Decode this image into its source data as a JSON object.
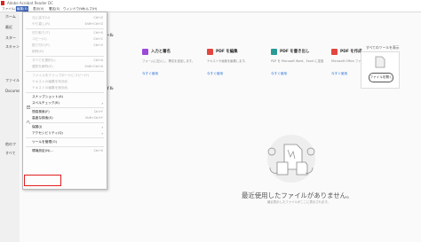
{
  "titlebar": {
    "title": "Adobe Acrobat Reader DC"
  },
  "menubar": {
    "items": [
      "ファイル(F)",
      "編集(E)",
      "表示(V)",
      "署名(S)",
      "ウィンドウ(W)",
      "ヘルプ(H)"
    ],
    "active_index": 1
  },
  "leftpane": {
    "labels": [
      "ホーム",
      "最近",
      "スター",
      "スキャン",
      "ファイル",
      "Document",
      "他のフ",
      "すべて"
    ]
  },
  "tools": {
    "section_suffix": "ール",
    "all_tools_link": "すべてのツールを表示",
    "cards": [
      {
        "title": "入力と署名",
        "desc": "フォームに記入し、署名を追加します。",
        "link": "今すぐ使用",
        "color": "#9c4ad8"
      },
      {
        "title": "PDF を編集",
        "desc": "テキストや画像を編集します。",
        "link": "今すぐ使用",
        "color": "#e2473f"
      },
      {
        "title": "PDF を書き出し",
        "desc": "PDF を Microsoft Word、Excel に変換",
        "link": "今すぐ使用",
        "color": "#2a9a95"
      },
      {
        "title": "PDF を作成",
        "desc": "Microsoft Office ファイルを PDF に変換",
        "link": "今すぐ使用",
        "color": "#e2473f"
      }
    ],
    "open_file_button": "ファイルを開く"
  },
  "recent": {
    "section_suffix": "イル",
    "empty_title": "最近使用したファイルがありません。",
    "empty_sub": "最近表示したファイルがここに表示されます。"
  },
  "edit_menu": {
    "items": [
      {
        "label": "元に戻す(U)",
        "shortcut": "Ctrl+Z",
        "enabled": false
      },
      {
        "label": "やり直し(R)",
        "shortcut": "Shift+Ctrl+Z",
        "enabled": false
      },
      {
        "sep": true
      },
      {
        "label": "切り取り(T)",
        "shortcut": "Ctrl+X",
        "enabled": false
      },
      {
        "label": "コピー(C)",
        "shortcut": "Ctrl+C",
        "enabled": false
      },
      {
        "label": "貼り付け(P)",
        "shortcut": "Ctrl+V",
        "enabled": false
      },
      {
        "label": "削除(D)",
        "shortcut": "",
        "enabled": false
      },
      {
        "sep": true
      },
      {
        "label": "すべてを選択(L)",
        "shortcut": "Ctrl+A",
        "enabled": false
      },
      {
        "label": "選択を解除(E)",
        "shortcut": "Shift+Ctrl+A",
        "enabled": false
      },
      {
        "sep": true
      },
      {
        "label": "ファイルをクリップボードにコピー(Y)",
        "shortcut": "",
        "enabled": false
      },
      {
        "label": "テキストの編集を有効化",
        "shortcut": "",
        "enabled": false
      },
      {
        "label": "テキストの編集を無効化",
        "shortcut": "",
        "enabled": false
      },
      {
        "sep": true
      },
      {
        "label": "スナップショット(A)",
        "shortcut": "",
        "enabled": true,
        "icon": "snapshot-icon"
      },
      {
        "label": "スペルチェック(K)",
        "shortcut": "",
        "enabled": true,
        "arrow": true
      },
      {
        "sep": true
      },
      {
        "label": "簡易検索(F)",
        "shortcut": "Ctrl+F",
        "enabled": true,
        "icon": "search-icon"
      },
      {
        "label": "高度な検索(S)",
        "shortcut": "Shift+Ctrl+F",
        "enabled": true
      },
      {
        "sep": true
      },
      {
        "label": "保護(J)",
        "shortcut": "",
        "enabled": true,
        "arrow": true
      },
      {
        "label": "アクセシビリティ(Q)",
        "shortcut": "",
        "enabled": true,
        "arrow": true
      },
      {
        "sep": true
      },
      {
        "label": "ツールを管理(O)",
        "shortcut": "",
        "enabled": true
      },
      {
        "sep": true
      },
      {
        "label": "環境設定(N)...",
        "shortcut": "Ctrl+K",
        "enabled": true
      }
    ]
  }
}
